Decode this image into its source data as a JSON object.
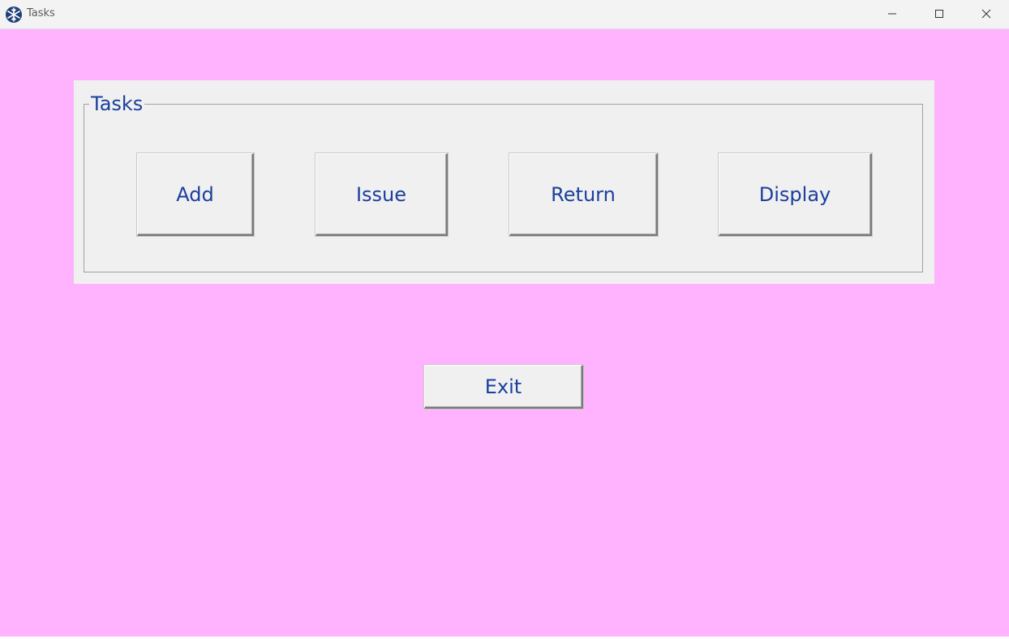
{
  "window": {
    "title": "Tasks",
    "icon": "snowflake-app-icon",
    "controls": [
      "minimize-icon",
      "maximize-icon",
      "close-icon"
    ]
  },
  "colors": {
    "client_background": "#ffb3ff",
    "panel_background": "#f0f0f0",
    "text_accent": "#1a3f9c"
  },
  "tasks_group": {
    "label": "Tasks",
    "buttons": {
      "add": "Add",
      "issue": "Issue",
      "return": "Return",
      "display": "Display"
    }
  },
  "exit_button": "Exit"
}
